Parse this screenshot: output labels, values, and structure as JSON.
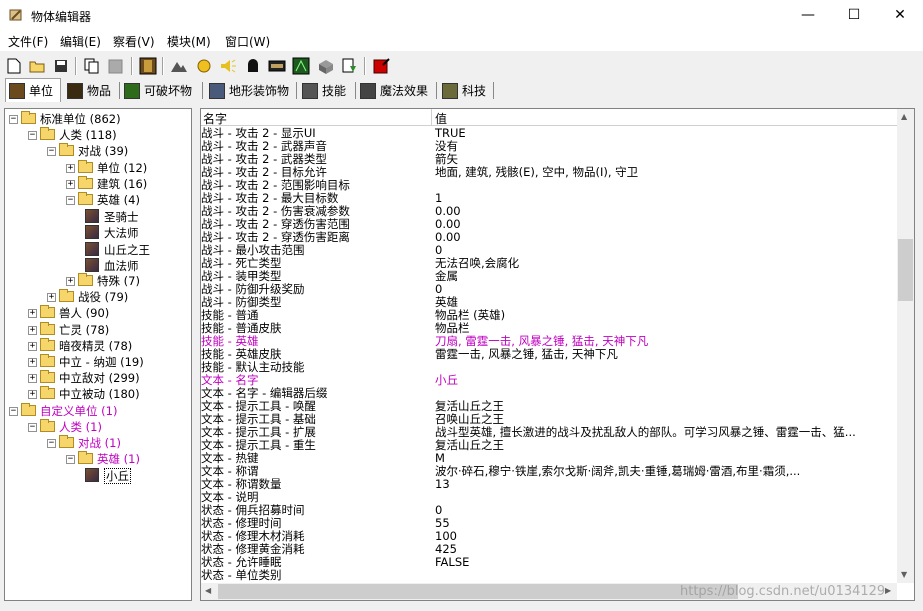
{
  "window": {
    "title": "物体编辑器",
    "minimize": "—",
    "maximize": "☐",
    "close": "✕"
  },
  "menu": [
    "文件(F)",
    "编辑(E)",
    "察看(V)",
    "模块(M)",
    "窗口(W)"
  ],
  "toolbar_icons": [
    "new-icon",
    "open-icon",
    "save-icon",
    "copy-icon",
    "paste-icon",
    "unit-editor-icon",
    "terrain-icon",
    "sound-icon",
    "object-icon",
    "import-icon",
    "trigger-icon",
    "campaign-icon",
    "ai-icon",
    "export-icon",
    "test-map-icon"
  ],
  "tabs": [
    "单位",
    "物品",
    "可破坏物",
    "地形装饰物",
    "技能",
    "魔法效果",
    "科技"
  ],
  "tree": [
    {
      "label": "标准单位 (862)",
      "level": 0,
      "exp": "-",
      "custom": false
    },
    {
      "label": "人类 (118)",
      "level": 1,
      "exp": "-",
      "custom": false
    },
    {
      "label": "对战 (39)",
      "level": 2,
      "exp": "-",
      "custom": false
    },
    {
      "label": "单位 (12)",
      "level": 3,
      "exp": "+",
      "custom": false
    },
    {
      "label": "建筑 (16)",
      "level": 3,
      "exp": "+",
      "custom": false
    },
    {
      "label": "英雄 (4)",
      "level": 3,
      "exp": "-",
      "custom": false
    },
    {
      "label": "圣骑士",
      "level": 4,
      "exp": "",
      "custom": false,
      "hero": true
    },
    {
      "label": "大法师",
      "level": 4,
      "exp": "",
      "custom": false,
      "hero": true
    },
    {
      "label": "山丘之王",
      "level": 4,
      "exp": "",
      "custom": false,
      "hero": true
    },
    {
      "label": "血法师",
      "level": 4,
      "exp": "",
      "custom": false,
      "hero": true
    },
    {
      "label": "特殊 (7)",
      "level": 3,
      "exp": "+",
      "custom": false
    },
    {
      "label": "战役 (79)",
      "level": 2,
      "exp": "+",
      "custom": false
    },
    {
      "label": "兽人 (90)",
      "level": 1,
      "exp": "+",
      "custom": false
    },
    {
      "label": "亡灵 (78)",
      "level": 1,
      "exp": "+",
      "custom": false
    },
    {
      "label": "暗夜精灵 (78)",
      "level": 1,
      "exp": "+",
      "custom": false
    },
    {
      "label": "中立 - 纳迦 (19)",
      "level": 1,
      "exp": "+",
      "custom": false
    },
    {
      "label": "中立敌对 (299)",
      "level": 1,
      "exp": "+",
      "custom": false
    },
    {
      "label": "中立被动 (180)",
      "level": 1,
      "exp": "+",
      "custom": false
    },
    {
      "label": "自定义单位 (1)",
      "level": 0,
      "exp": "-",
      "custom": true
    },
    {
      "label": "人类 (1)",
      "level": 1,
      "exp": "-",
      "custom": true
    },
    {
      "label": "对战 (1)",
      "level": 2,
      "exp": "-",
      "custom": true
    },
    {
      "label": "英雄 (1)",
      "level": 3,
      "exp": "-",
      "custom": true
    },
    {
      "label": "小丘",
      "level": 4,
      "exp": "",
      "custom": false,
      "hero": true,
      "selected": true
    }
  ],
  "grid": {
    "col_name": "名字",
    "col_value": "值",
    "rows": [
      {
        "n": "战斗 - 攻击 2 - 显示UI",
        "v": "TRUE"
      },
      {
        "n": "战斗 - 攻击 2 - 武器声音",
        "v": "没有"
      },
      {
        "n": "战斗 - 攻击 2 - 武器类型",
        "v": "箭矢"
      },
      {
        "n": "战斗 - 攻击 2 - 目标允许",
        "v": "地面, 建筑, 残骸(E), 空中, 物品(I), 守卫"
      },
      {
        "n": "战斗 - 攻击 2 - 范围影响目标",
        "v": ""
      },
      {
        "n": "战斗 - 攻击 2 - 最大目标数",
        "v": "1"
      },
      {
        "n": "战斗 - 攻击 2 - 伤害衰减参数",
        "v": "0.00"
      },
      {
        "n": "战斗 - 攻击 2 - 穿透伤害范围",
        "v": "0.00"
      },
      {
        "n": "战斗 - 攻击 2 - 穿透伤害距离",
        "v": "0.00"
      },
      {
        "n": "战斗 - 最小攻击范围",
        "v": "0"
      },
      {
        "n": "战斗 - 死亡类型",
        "v": "无法召唤,会腐化"
      },
      {
        "n": "战斗 - 装甲类型",
        "v": "金属"
      },
      {
        "n": "战斗 - 防御升级奖励",
        "v": "0"
      },
      {
        "n": "战斗 - 防御类型",
        "v": "英雄"
      },
      {
        "n": "技能 - 普通",
        "v": "物品栏 (英雄)"
      },
      {
        "n": "技能 - 普通皮肤",
        "v": "物品栏"
      },
      {
        "n": "技能 - 英雄",
        "v": "刀扇, 雷霆一击, 风暴之锤, 猛击, 天神下凡",
        "custom": true
      },
      {
        "n": "技能 - 英雄皮肤",
        "v": "雷霆一击, 风暴之锤, 猛击, 天神下凡"
      },
      {
        "n": "技能 - 默认主动技能",
        "v": ""
      },
      {
        "n": "文本 - 名字",
        "v": "小丘",
        "custom": true
      },
      {
        "n": "文本 - 名字 - 编辑器后缀",
        "v": ""
      },
      {
        "n": "文本 - 提示工具 - 唤醒",
        "v": "复活山丘之王"
      },
      {
        "n": "文本 - 提示工具 - 基础",
        "v": "召唤山丘之王"
      },
      {
        "n": "文本 - 提示工具 - 扩展",
        "v": "战斗型英雄, 擅长激进的战斗及扰乱敌人的部队。可学习风暴之锤、雷霆一击、猛..."
      },
      {
        "n": "文本 - 提示工具 - 重生",
        "v": "复活山丘之王"
      },
      {
        "n": "文本 - 热键",
        "v": "M"
      },
      {
        "n": "文本 - 称谓",
        "v": "波尔·碎石,穆宁·铁崖,索尔戈斯·阔斧,凯夫·重锤,葛瑞姆·雷酒,布里·霜须,..."
      },
      {
        "n": "文本 - 称谓数量",
        "v": "13"
      },
      {
        "n": "文本 - 说明",
        "v": ""
      },
      {
        "n": "状态 - 佣兵招募时间",
        "v": "0"
      },
      {
        "n": "状态 - 修理时间",
        "v": "55"
      },
      {
        "n": "状态 - 修理木材消耗",
        "v": "100"
      },
      {
        "n": "状态 - 修理黄金消耗",
        "v": "425"
      },
      {
        "n": "状态 - 允许睡眠",
        "v": "FALSE"
      },
      {
        "n": "状态 - 单位类别",
        "v": ""
      }
    ]
  },
  "watermark": "https://blog.csdn.net/u0134129"
}
